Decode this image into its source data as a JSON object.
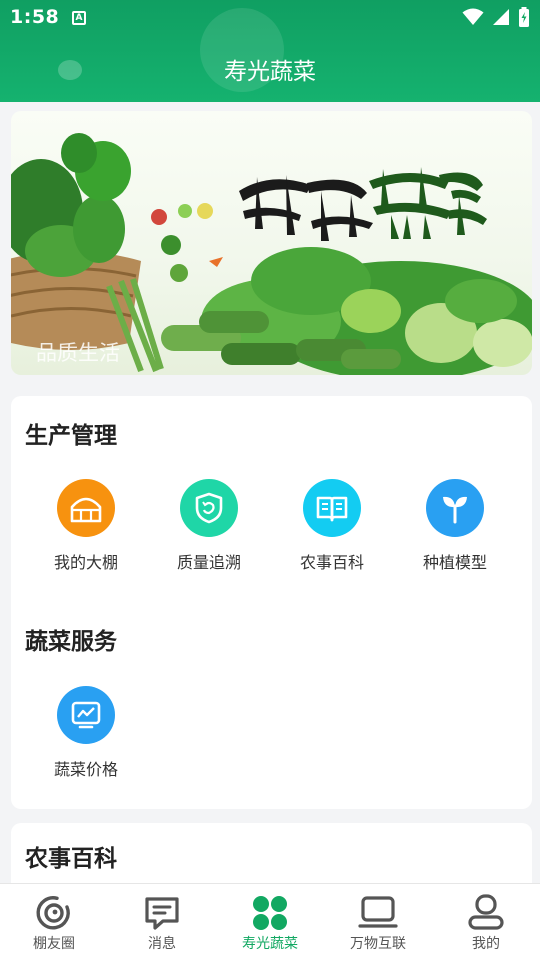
{
  "status_bar": {
    "time": "1:58",
    "notification_icon_letter": "A"
  },
  "header": {
    "title": "寿光蔬菜"
  },
  "banner": {
    "headline": "新鲜蔬菜",
    "caption": "品质生活"
  },
  "production": {
    "title": "生产管理",
    "items": [
      {
        "label": "我的大棚",
        "icon": "greenhouse-icon",
        "color": "#f7920f"
      },
      {
        "label": "质量追溯",
        "icon": "trace-shield-icon",
        "color": "#1fd6a7"
      },
      {
        "label": "农事百科",
        "icon": "book-icon",
        "color": "#13ccf2"
      },
      {
        "label": "种植模型",
        "icon": "sprout-icon",
        "color": "#29a0f2"
      }
    ]
  },
  "vegetable_service": {
    "title": "蔬菜服务",
    "items": [
      {
        "label": "蔬菜价格",
        "icon": "price-chart-icon",
        "color": "#29a0f2"
      }
    ]
  },
  "encyclopedia": {
    "title": "农事百科"
  },
  "bottom_nav": {
    "active_color": "#12a862",
    "items": [
      {
        "label": "棚友圈",
        "icon": "moments-icon"
      },
      {
        "label": "消息",
        "icon": "message-icon"
      },
      {
        "label": "寿光蔬菜",
        "icon": "grid-dots-icon",
        "active": true
      },
      {
        "label": "万物互联",
        "icon": "devices-icon"
      },
      {
        "label": "我的",
        "icon": "profile-icon"
      }
    ]
  }
}
